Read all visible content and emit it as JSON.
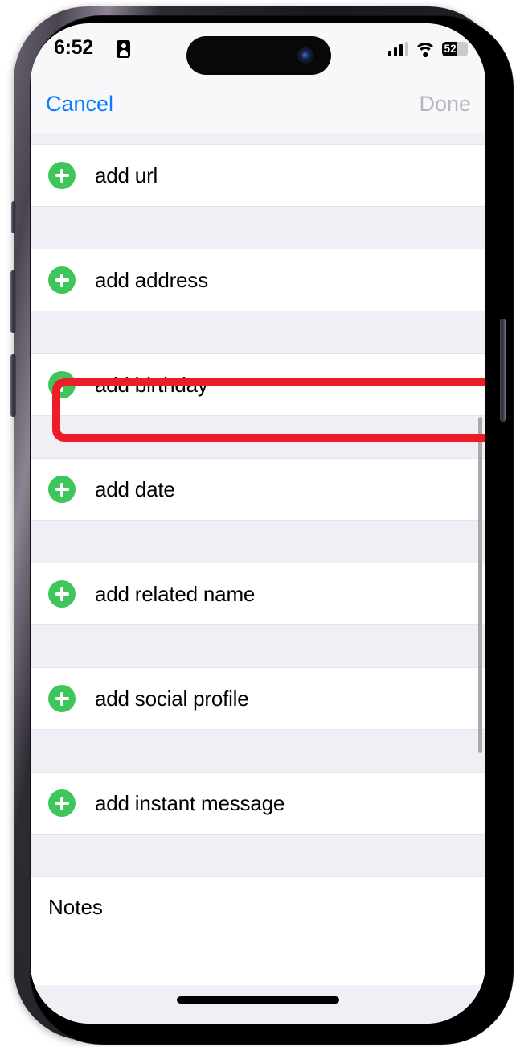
{
  "status_bar": {
    "time": "6:52",
    "contact_card_icon": "contact-card-icon",
    "cellular_icon": "cellular-signal-icon",
    "wifi_icon": "wifi-icon",
    "battery_level_text": "52",
    "battery_percent": 55
  },
  "nav_bar": {
    "cancel_label": "Cancel",
    "done_label": "Done",
    "cancel_color": "#0a7cff",
    "done_color": "#b6b6bb"
  },
  "form": {
    "add_icon": "plus-circle-icon",
    "add_icon_color": "#3ec65a",
    "rows": [
      {
        "label": "add url"
      },
      {
        "label": "add address"
      },
      {
        "label": "add birthday"
      },
      {
        "label": "add date"
      },
      {
        "label": "add related name"
      },
      {
        "label": "add social profile"
      },
      {
        "label": "add instant message"
      }
    ],
    "notes_label": "Notes"
  },
  "annotation": {
    "highlight_target": "add birthday",
    "highlight_color": "#ed1c29"
  },
  "device": {
    "home_indicator": "home-indicator",
    "dynamic_island": "dynamic-island"
  }
}
